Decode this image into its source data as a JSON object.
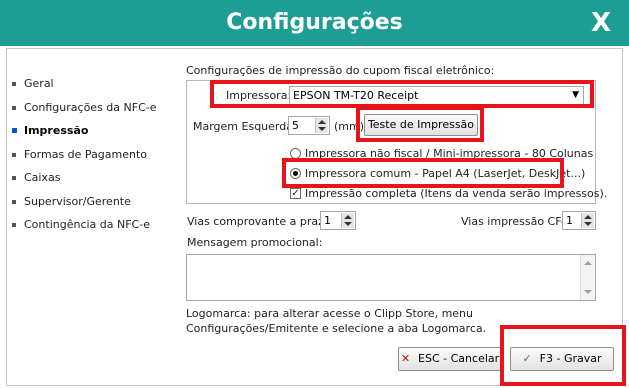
{
  "window": {
    "title": "Configurações",
    "close_label": "X"
  },
  "sidebar": {
    "items": [
      {
        "label": "Geral"
      },
      {
        "label": "Configurações da NFC-e"
      },
      {
        "label": "Impressão"
      },
      {
        "label": "Formas de Pagamento"
      },
      {
        "label": "Caixas"
      },
      {
        "label": "Supervisor/Gerente"
      },
      {
        "label": "Contingência da NFC-e"
      }
    ],
    "active_label": "Impressão"
  },
  "print": {
    "heading": "Configurações de impressão do cupom fiscal eletrônico:",
    "printer_label": "Impressora:",
    "printer_value": "EPSON TM-T20 Receipt",
    "margin_label": "Margem Esquerda:",
    "margin_value": "5",
    "margin_unit": "(mm)",
    "test_button": "Teste de Impressão",
    "radio_nonfiscal": "Impressora não fiscal / Mini-impressora - 80 Colunas",
    "radio_common": "Impressora comum - Papel A4 (LaserJet, DeskJet...)",
    "selected_option": "Impressora comum - Papel A4 (LaserJet, DeskJet...)",
    "full_print_label": "Impressão completa (Itens da venda serão impressos).",
    "full_print_checked": true
  },
  "copies": {
    "term_label": "Vias comprovante a prazo:",
    "term_value": "1",
    "cfe_label": "Vias impressão CFe:",
    "cfe_value": "1"
  },
  "promo": {
    "label": "Mensagem promocional:",
    "value": ""
  },
  "logo_info": "Logomarca: para alterar acesse o Clipp Store, menu Configurações/Emitente e selecione a aba Logomarca.",
  "footer": {
    "cancel_label": "ESC - Cancelar",
    "save_label": "F3 - Gravar"
  },
  "icons": {
    "cancel": "x-icon",
    "save": "check-icon",
    "bullet": "square-bullet-icon"
  },
  "colors": {
    "titlebar": "#1e9d94",
    "highlight": "#e8141c",
    "active_bullet": "#1050c8"
  }
}
